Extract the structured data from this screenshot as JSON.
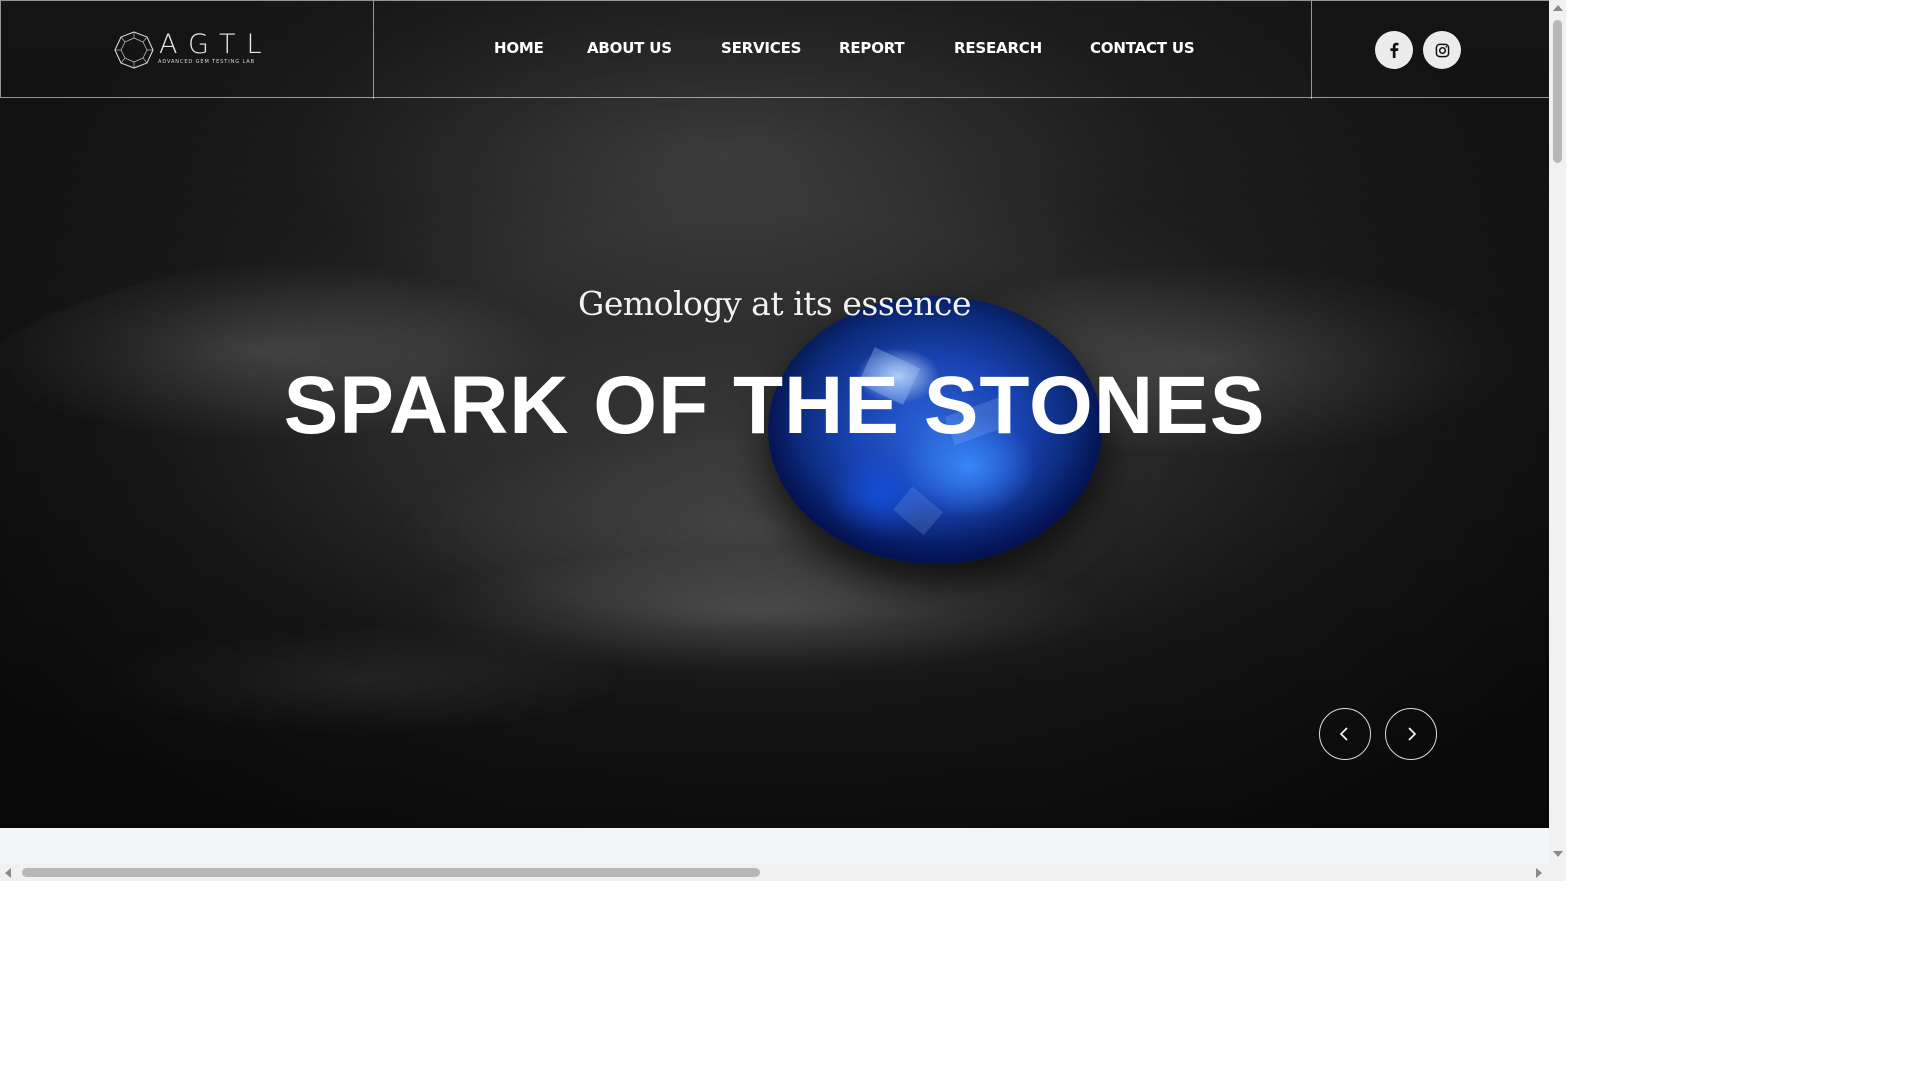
{
  "brand": {
    "logo_text": "AGTL",
    "logo_subtitle": "ADVANCED GEM TESTING LAB"
  },
  "nav": {
    "items": [
      {
        "id": "home",
        "label": "HOME"
      },
      {
        "id": "about",
        "label": "ABOUT US"
      },
      {
        "id": "services",
        "label": "SERVICES"
      },
      {
        "id": "report",
        "label": "REPORT"
      },
      {
        "id": "research",
        "label": "RESEARCH"
      },
      {
        "id": "contact",
        "label": "CONTACT US"
      }
    ]
  },
  "social": {
    "icons": [
      "facebook-icon",
      "instagram-icon"
    ]
  },
  "hero": {
    "tagline": "Gemology at its essence",
    "headline": "SPARK OF THE STONES",
    "prev_icon": "chevron-left-icon",
    "next_icon": "chevron-right-icon"
  },
  "colors": {
    "text_light": "#ffffff",
    "social_bg": "#ececec",
    "gem_blue": "#1944b4",
    "scrollbar_thumb": "#b7b7b7"
  }
}
